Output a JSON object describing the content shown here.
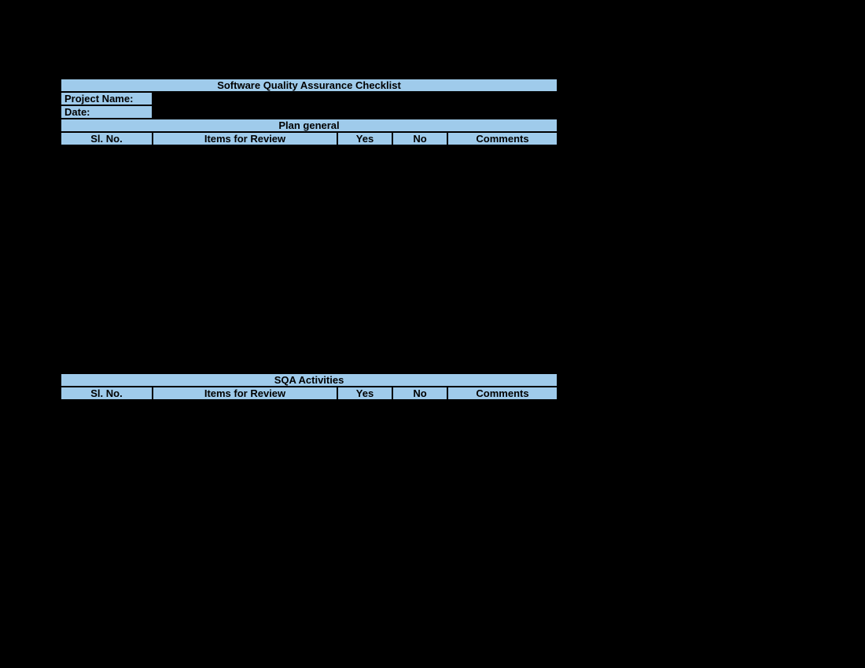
{
  "title": "Software Quality Assurance Checklist",
  "fields": {
    "project_name_label": "Project Name:",
    "date_label": "Date:"
  },
  "sections": [
    {
      "header": "Plan general",
      "columns": {
        "sl_no": "Sl. No.",
        "items": "Items for Review",
        "yes": "Yes",
        "no": "No",
        "comments": "Comments"
      }
    },
    {
      "header": "SQA Activities",
      "columns": {
        "sl_no": "Sl. No.",
        "items": "Items for Review",
        "yes": "Yes",
        "no": "No",
        "comments": "Comments"
      }
    }
  ]
}
